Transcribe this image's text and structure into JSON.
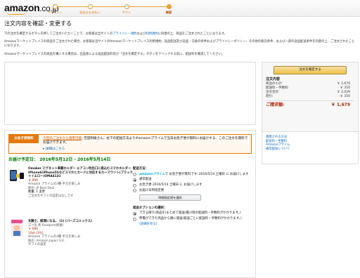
{
  "header": {
    "logo_text": "amazon",
    "logo_tld": ".co.jp",
    "steps": [
      "サインイン",
      "配送＆お支払い",
      "ギフト",
      "確認"
    ],
    "active_step": 3
  },
  "title": "注文内容を確認・変更する",
  "intro": {
    "line1": "下の注文を確定するボタンを押してご注文いただくことで、お客様は当サイトの",
    "link1": "プライバシー規約",
    "line1b": "および",
    "link2": "利用規約",
    "line1c": "に同意の上、商品をご注文されたことになります。",
    "line2": "Amazonマーケットプレイスの商品をご注文された場合、お客様は当サイトのAmazonマーケットプレイス利用規約、送品配送及び返品・交換の条件およびプライバシーポリシー、その他の販売条件、および一部の送品配送条件を同意の上、ご注文されたことになります。",
    "line3": "Amazonマーケットプレイスの商品を購入する場合は、出品者による送品配送料及び「注文を確定する」ボタンをクリックする前に、配送料を確認してください。"
  },
  "summary": {
    "confirm_button": "注文を確定する",
    "title": "注文内容",
    "rows": [
      {
        "label": "商品の小計:",
        "value": "￥ 1,679"
      },
      {
        "label": "配送料・手数料:",
        "value": "￥ 350"
      },
      {
        "label": "注文合計:",
        "value": "￥ 2,029"
      },
      {
        "label": "割引:",
        "value": "-￥ 350"
      }
    ],
    "total_label": "ご請求額:",
    "total_value": "￥ 1,679"
  },
  "side_links": [
    "連携される方法",
    "配送料・手数料",
    "Amazonプライム",
    "通常配送について"
  ],
  "promo": {
    "badge": "お急ぎ便無料",
    "text_highlight": "今回のご注文から適用可能",
    "text": ": 吉田和樹さん、右下の配送方法より#amazonプライムで当日お急ぎ便が無料にお届けする、このご注文を無料でお届けできます。",
    "details": "▸ 詳細はこちら"
  },
  "delivery_date": "お届け予定日： 2016年5月12日 - 2016年5月14日",
  "items": [
    {
      "name": "Omaker マグネット車載ホルダー エアコン吹出口に差込むスマホホルダー iPhone6/iPhone5Sなどスマホとカードに対応するカーマウント(ブラック＋イエロー)OMA4131",
      "price": "￥ 999",
      "prime": "Amazon プライムの3種 手元を楽しみ",
      "seller": "販売: JP Best Deal",
      "qty": "数量: 1 変更",
      "gift": "ご注文をギフトの設定はなしです"
    },
    {
      "name": "女騎士、経理になる。 (1) (バーズコミックス)",
      "author": "三ツ矢 彰 Rootport(原著)",
      "price": "￥ 680",
      "points": "10pt (3%)",
      "prime": "Amazon プライムの3種 手元を楽しみ",
      "seller": "販売: Amazon Japan G.K.",
      "gift": "ギフトの設定"
    }
  ],
  "shipping_options": {
    "title": "配送方法：",
    "options": [
      {
        "prime": "amazonプライム",
        "text": "で お急ぎ便が無料です: 2016/5/14 土曜日 に お届けします",
        "selected": false
      },
      {
        "text": "通常配送",
        "selected": true
      },
      {
        "text": "お急ぎ便 2016/5/14 土曜日 に お届けします",
        "selected": false
      },
      {
        "text": "お届け日時指定便",
        "selected": false
      }
    ],
    "date_button": "時間指定便を選択"
  },
  "ship_opts2": {
    "title": "発送オプションの選択：",
    "options": [
      {
        "text": "できる限り(商品を)まとめて発送(最小限の配送料・手数料がかかります。)",
        "selected": true
      },
      {
        "text": "準備ができた商品から順に発送(発送ごとに配送料・手数料がかかります。)",
        "selected": false
      }
    ],
    "detail": "(詳細を見る)"
  },
  "colors": {
    "accent": "#f0c14b",
    "price": "#b12704",
    "link": "#0066c0",
    "green": "#007600",
    "orange": "#e47911"
  }
}
